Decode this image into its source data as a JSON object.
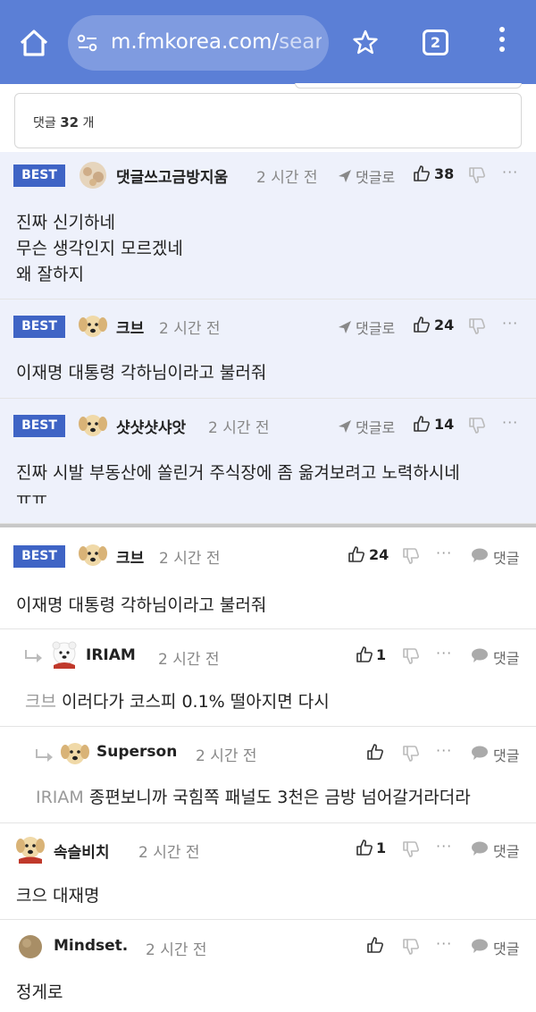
{
  "browser": {
    "url_main": "m.fmkorea.com/",
    "url_rest": "sear",
    "tab_count": "2",
    "icons": [
      "home-icon",
      "site-settings-icon",
      "star-icon",
      "tabs-icon",
      "more-vert-icon"
    ]
  },
  "comment_count": {
    "label": "댓글",
    "count": "32",
    "unit": "개"
  },
  "best_comments": [
    {
      "badge": "BEST",
      "nick": "댓글쓰고금방지움",
      "time": "2 시간 전",
      "reply": "댓글로",
      "likes": "38",
      "body": [
        "진짜 신기하네",
        "무슨 생각인지 모르겠네",
        "왜 잘하지"
      ]
    },
    {
      "badge": "BEST",
      "nick": "크브",
      "time": "2 시간 전",
      "reply": "댓글로",
      "likes": "24",
      "body": [
        "이재명 대통령 각하님이라고 불러줘"
      ]
    },
    {
      "badge": "BEST",
      "nick": "샷샷샷샤앗",
      "time": "2 시간 전",
      "reply": "댓글로",
      "likes": "14",
      "body": [
        "진짜 시발 부동산에 쏠린거 주식장에 좀 옮겨보려고 노력하시네",
        "ㅠㅠ"
      ]
    }
  ],
  "comments": [
    {
      "badge": "BEST",
      "nick": "크브",
      "time": "2 시간 전",
      "likes": "24",
      "more": "···",
      "reply": "댓글",
      "body": "이재명 대통령 각하님이라고 불러줘"
    },
    {
      "nick": "IRIAM",
      "time": "2 시간 전",
      "likes": "1",
      "more": "···",
      "reply": "댓글",
      "mention": "크브",
      "body": "이러다가 코스피 0.1% 떨아지면 다시"
    },
    {
      "nick": "Superson",
      "time": "2 시간 전",
      "likes": "",
      "more": "···",
      "reply": "댓글",
      "mention": "IRIAM",
      "body": "종편보니까 국힘쪽 패널도 3천은 금방 넘어갈거라더라"
    },
    {
      "nick": "속슬비치",
      "time": "2 시간 전",
      "likes": "1",
      "more": "···",
      "reply": "댓글",
      "body": "크으 대재명"
    },
    {
      "nick": "Mindset.",
      "time": "2 시간 전",
      "likes": "",
      "more": "···",
      "reply": "댓글",
      "body": "정게로"
    }
  ],
  "colors": {
    "browser_bar": "#5b7fd6",
    "best_badge": "#3f64c5",
    "best_bg": "#eef1fb"
  }
}
